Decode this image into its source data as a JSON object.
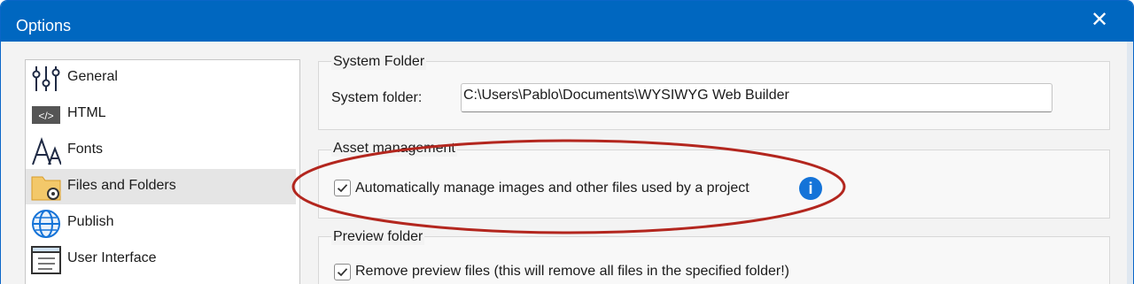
{
  "window": {
    "title": "Options",
    "close_glyph": "✕"
  },
  "nav": {
    "items": [
      {
        "label": "General",
        "icon": "general-sliders-icon"
      },
      {
        "label": "HTML",
        "icon": "html-code-icon"
      },
      {
        "label": "Fonts",
        "icon": "fonts-icon"
      },
      {
        "label": "Files and Folders",
        "icon": "folder-gear-icon",
        "selected": true
      },
      {
        "label": "Publish",
        "icon": "globe-icon"
      },
      {
        "label": "User Interface",
        "icon": "window-list-icon"
      }
    ]
  },
  "system_folder": {
    "group_title": "System Folder",
    "label": "System folder:",
    "value": "C:\\Users\\Pablo\\Documents\\WYSIWYG Web Builder",
    "browse_icon": "folder-search-icon"
  },
  "asset_management": {
    "group_title": "Asset management",
    "checkbox_label": "Automatically manage images and other files used by a project",
    "checked": true,
    "info_glyph": "i",
    "highlight_color": "#b3261e"
  },
  "preview_folder": {
    "group_title": "Preview folder",
    "checkbox_label": "Remove preview files (this will remove all files in the specified folder!)",
    "checked": true
  },
  "colors": {
    "title_bar": "#0067c0",
    "selected_nav": "#e5e5e5",
    "info_blue": "#1473d8"
  }
}
